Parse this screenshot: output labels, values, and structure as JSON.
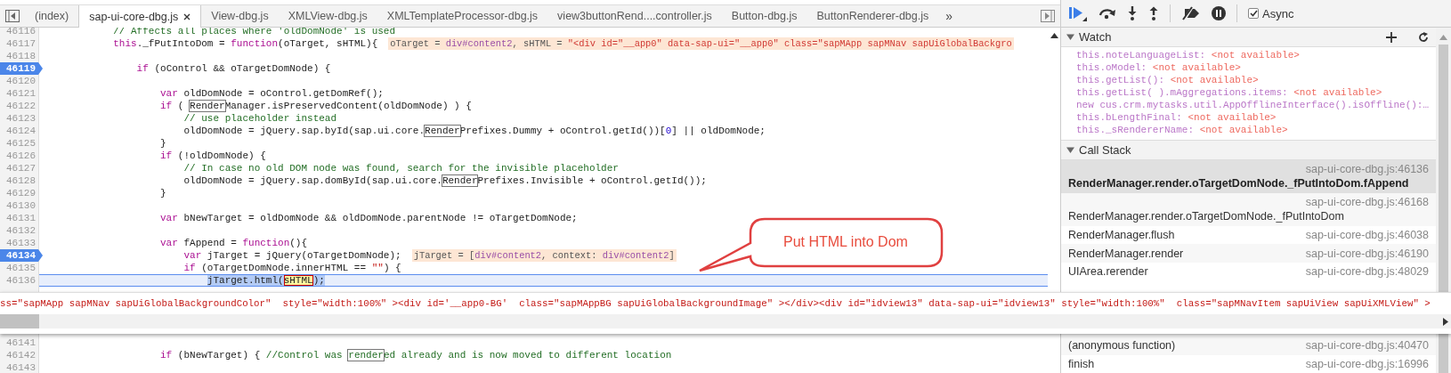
{
  "tabs": [
    {
      "label": "(index)",
      "selected": false
    },
    {
      "label": "sap-ui-core-dbg.js",
      "selected": true
    },
    {
      "label": "View-dbg.js",
      "selected": false
    },
    {
      "label": "XMLView-dbg.js",
      "selected": false
    },
    {
      "label": "XMLTemplateProcessor-dbg.js",
      "selected": false
    },
    {
      "label": "view3buttonRend....controller.js",
      "selected": false
    },
    {
      "label": "Button-dbg.js",
      "selected": false
    },
    {
      "label": "ButtonRenderer-dbg.js",
      "selected": false
    }
  ],
  "tabs_overflow": "»",
  "editor": {
    "lines_before_popup": [
      {
        "number": "46116",
        "breakpoint": false,
        "current": false,
        "tokens": [
          {
            "text": "            // Affects all places where 'oldDomNode' is used",
            "kind": "comment"
          }
        ]
      },
      {
        "number": "46117",
        "breakpoint": false,
        "current": false,
        "tokens": [
          {
            "text": "            this",
            "kind": "keyword"
          },
          {
            "text": "._fPutIntoDom = ",
            "kind": "plain"
          },
          {
            "text": "function",
            "kind": "keyword"
          },
          {
            "text": "(oTarget, sHTML){",
            "kind": "plain"
          }
        ],
        "inline_value": [
          {
            "text": "oTarget = ",
            "kind": "plain"
          },
          {
            "text": "div#content2",
            "kind": "object"
          },
          {
            "text": ", sHTML = ",
            "kind": "plain"
          },
          {
            "text": "\"<div id=\"__app0\" data-sap-ui=\"__app0\" class=\"sapMApp sapMNav sapUiGlobalBackgro",
            "kind": "string"
          }
        ]
      },
      {
        "number": "46118",
        "breakpoint": false,
        "current": false
      },
      {
        "number": "46119",
        "breakpoint": true,
        "current": false,
        "tokens": [
          {
            "text": "                if",
            "kind": "keyword"
          },
          {
            "text": " (oControl && oTargetDomNode) {",
            "kind": "plain"
          }
        ]
      },
      {
        "number": "46120",
        "breakpoint": false,
        "current": false
      },
      {
        "number": "46121",
        "breakpoint": false,
        "current": false,
        "tokens": [
          {
            "text": "                    var",
            "kind": "keyword"
          },
          {
            "text": " oldDomNode = oControl.getDomRef();",
            "kind": "plain"
          }
        ]
      },
      {
        "number": "46122",
        "breakpoint": false,
        "current": false,
        "tokens": [
          {
            "text": "                    if",
            "kind": "keyword"
          },
          {
            "text": " ( ",
            "kind": "plain"
          },
          {
            "text": "Render",
            "kind": "plain",
            "match": true
          },
          {
            "text": "Manager.isPreservedContent(oldDomNode) ) {",
            "kind": "plain"
          }
        ]
      },
      {
        "number": "46123",
        "breakpoint": false,
        "current": false,
        "tokens": [
          {
            "text": "                        // use placeholder instead",
            "kind": "comment"
          }
        ]
      },
      {
        "number": "46124",
        "breakpoint": false,
        "current": false,
        "tokens": [
          {
            "text": "                        oldDomNode = jQuery.sap.byId(sap.ui.core.",
            "kind": "plain"
          },
          {
            "text": "Render",
            "kind": "plain",
            "match": true
          },
          {
            "text": "Prefixes.Dummy + oControl.getId())[",
            "kind": "plain"
          },
          {
            "text": "0",
            "kind": "number"
          },
          {
            "text": "] || oldDomNode;",
            "kind": "plain"
          }
        ]
      },
      {
        "number": "46125",
        "breakpoint": false,
        "current": false,
        "tokens": [
          {
            "text": "                    }",
            "kind": "plain"
          }
        ]
      },
      {
        "number": "46126",
        "breakpoint": false,
        "current": false,
        "tokens": [
          {
            "text": "                    if",
            "kind": "keyword"
          },
          {
            "text": " (!oldDomNode) {",
            "kind": "plain"
          }
        ]
      },
      {
        "number": "46127",
        "breakpoint": false,
        "current": false,
        "tokens": [
          {
            "text": "                        // In case no old DOM node was found, search for the invisible placeholder",
            "kind": "comment"
          }
        ]
      },
      {
        "number": "46128",
        "breakpoint": false,
        "current": false,
        "tokens": [
          {
            "text": "                        oldDomNode = jQuery.sap.domById(sap.ui.core.",
            "kind": "plain"
          },
          {
            "text": "Render",
            "kind": "plain",
            "match": true
          },
          {
            "text": "Prefixes.Invisible + oControl.getId());",
            "kind": "plain"
          }
        ]
      },
      {
        "number": "46129",
        "breakpoint": false,
        "current": false,
        "tokens": [
          {
            "text": "                    }",
            "kind": "plain"
          }
        ]
      },
      {
        "number": "46130",
        "breakpoint": false,
        "current": false
      },
      {
        "number": "46131",
        "breakpoint": false,
        "current": false,
        "tokens": [
          {
            "text": "                    var",
            "kind": "keyword"
          },
          {
            "text": " bNewTarget = oldDomNode && oldDomNode.parentNode != oTargetDomNode;",
            "kind": "plain"
          }
        ]
      },
      {
        "number": "46132",
        "breakpoint": false,
        "current": false
      },
      {
        "number": "46133",
        "breakpoint": false,
        "current": false,
        "tokens": [
          {
            "text": "                    var",
            "kind": "keyword"
          },
          {
            "text": " fAppend = ",
            "kind": "plain"
          },
          {
            "text": "function",
            "kind": "keyword"
          },
          {
            "text": "(){",
            "kind": "plain"
          }
        ]
      },
      {
        "number": "46134",
        "breakpoint": true,
        "current": false,
        "tokens": [
          {
            "text": "                        var",
            "kind": "keyword"
          },
          {
            "text": " jTarget = jQuery(oTargetDomNode);",
            "kind": "plain"
          }
        ],
        "inline_value": [
          {
            "text": "jTarget = [",
            "kind": "plain"
          },
          {
            "text": "div#content2",
            "kind": "object"
          },
          {
            "text": ", context: ",
            "kind": "plain"
          },
          {
            "text": "div#content2",
            "kind": "object"
          },
          {
            "text": "]",
            "kind": "plain"
          }
        ]
      },
      {
        "number": "46135",
        "breakpoint": false,
        "current": false,
        "tokens": [
          {
            "text": "                        if",
            "kind": "keyword"
          },
          {
            "text": " (oTargetDomNode.innerHTML == ",
            "kind": "plain"
          },
          {
            "text": "\"\"",
            "kind": "string"
          },
          {
            "text": ") {",
            "kind": "plain"
          }
        ]
      },
      {
        "number": "46136",
        "breakpoint": false,
        "current": true,
        "tokens": [
          {
            "text": "                            jTarget.html(",
            "kind": "selection"
          },
          {
            "text": "sHTML",
            "kind": "hover"
          },
          {
            "text": ");",
            "kind": "selection"
          }
        ]
      }
    ],
    "lines_after_popup": [
      {
        "number": "46141",
        "breakpoint": false,
        "current": false
      },
      {
        "number": "46142",
        "breakpoint": false,
        "current": false,
        "tokens": [
          {
            "text": "                    if",
            "kind": "keyword"
          },
          {
            "text": " (bNewTarget) { ",
            "kind": "plain"
          },
          {
            "text": "//Control was ",
            "kind": "comment"
          },
          {
            "text": "render",
            "kind": "comment",
            "match": true
          },
          {
            "text": "ed already and is now moved to different location",
            "kind": "comment"
          }
        ]
      },
      {
        "number": "46143",
        "breakpoint": false,
        "current": false
      }
    ]
  },
  "popup": {
    "text": "ss=\"sapMApp sapMNav sapUiGlobalBackgroundColor\"  style=\"width:100%\" ><div id='__app0-BG'  class=\"sapMAppBG sapUiGlobalBackgroundImage\" ></div><div id=\"idview13\" data-sap-ui=\"idview13\" style=\"width:100%\"  class=\"sapMNavItem sapUiView sapUiXMLView\" >"
  },
  "callout": {
    "text": "Put HTML into Dom"
  },
  "debugger": {
    "async": {
      "label": "Async",
      "checked": true
    },
    "watch": {
      "title": "Watch",
      "expanded": true,
      "items": [
        {
          "name": "this.noteLanguageList:",
          "value": "<not available>"
        },
        {
          "name": "this.oModel:",
          "value": "<not available>"
        },
        {
          "name": "this.getList():",
          "value": "<not available>"
        },
        {
          "name": "this.getList( ).mAggregations.items:",
          "value": "<not available>"
        },
        {
          "name": "new cus.crm.mytasks.util.AppOfflineInterface().isOffline():…"
        },
        {
          "name": "this.bLengthFinal:",
          "value": "<not available>"
        },
        {
          "name": "this._sRendererName:",
          "value": "<not available>"
        }
      ]
    },
    "call_stack": {
      "title": "Call Stack",
      "expanded": true,
      "frames_before_popup": [
        {
          "kind": "two_line",
          "function": "RenderManager.render.oTargetDomNode._fPutIntoDom.fAppend",
          "location": "sap-ui-core-dbg.js:46136",
          "selected": true
        },
        {
          "kind": "two_line",
          "function": "RenderManager.render.oTargetDomNode._fPutIntoDom",
          "location": "sap-ui-core-dbg.js:46168",
          "selected": false
        },
        {
          "kind": "one_line",
          "function": "RenderManager.flush",
          "location": "sap-ui-core-dbg.js:46038",
          "selected": false
        },
        {
          "kind": "one_line",
          "function": "RenderManager.render",
          "location": "sap-ui-core-dbg.js:46190",
          "selected": false
        },
        {
          "kind": "one_line",
          "function": "UIArea.rerender",
          "location": "sap-ui-core-dbg.js:48029",
          "selected": false
        }
      ],
      "frames_after_popup": [
        {
          "kind": "one_line",
          "function": "(anonymous function)",
          "location": "sap-ui-core-dbg.js:40470",
          "selected": false
        },
        {
          "kind": "one_line",
          "function": "finish",
          "location": "sap-ui-core-dbg.js:16996",
          "selected": false
        }
      ]
    }
  }
}
